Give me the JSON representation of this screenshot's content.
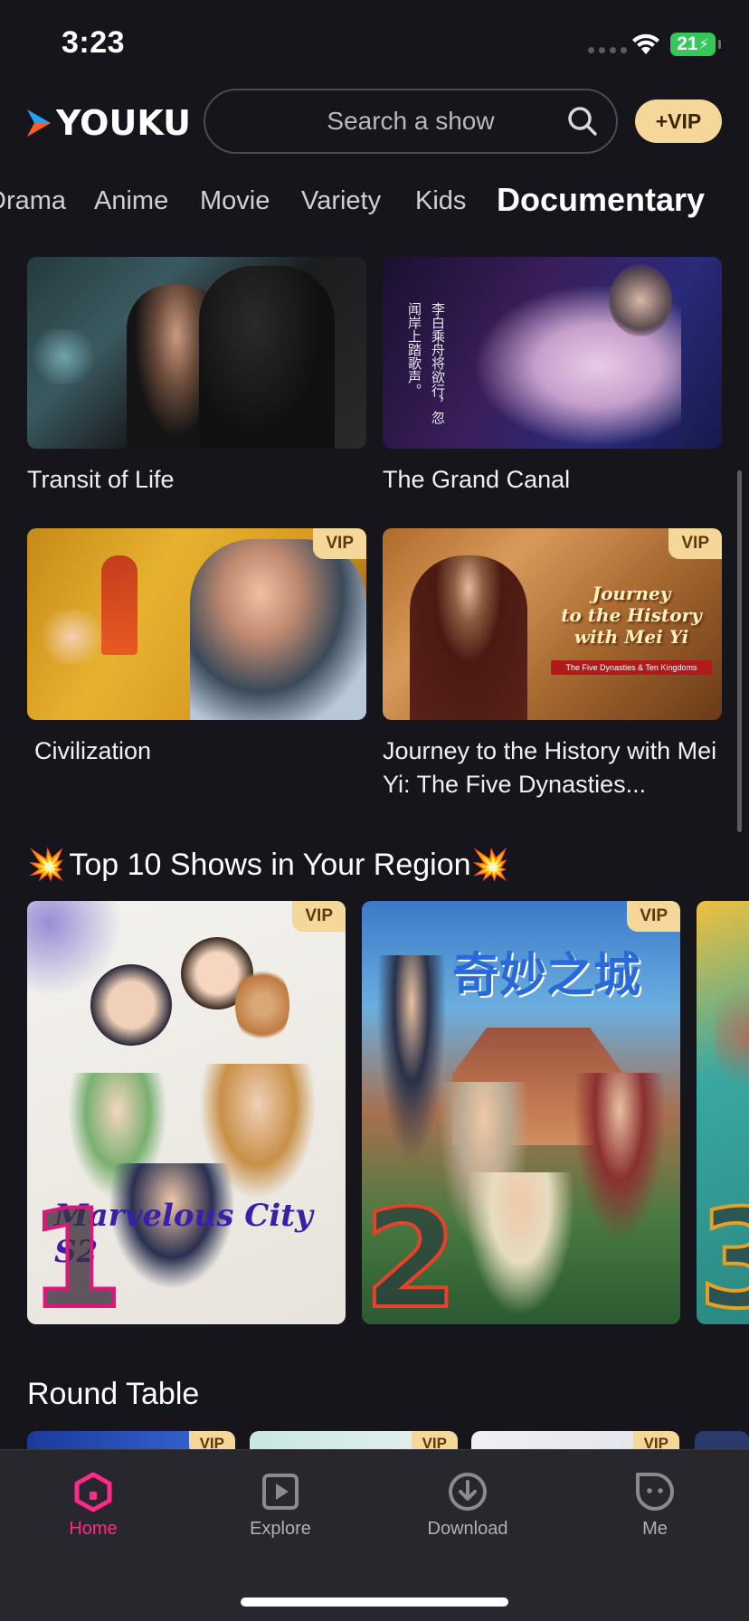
{
  "status": {
    "time": "3:23",
    "battery": "21"
  },
  "header": {
    "logo_text": "YOUKU",
    "search_placeholder": "Search a show",
    "vip_label": "+VIP"
  },
  "tabs": [
    {
      "label": "Drama"
    },
    {
      "label": "Anime"
    },
    {
      "label": "Movie"
    },
    {
      "label": "Variety"
    },
    {
      "label": "Kids"
    },
    {
      "label": "Documentary",
      "active": true
    }
  ],
  "grid": [
    {
      "title": "Transit of Life",
      "vip": false
    },
    {
      "title": "The Grand Canal",
      "vip": false
    },
    {
      "title": "Civilization",
      "vip": true
    },
    {
      "title": "Journey to the History with Mei Yi: The Five Dynasties...",
      "vip": true
    }
  ],
  "thumb_texts": {
    "canal_caption": "李白乘舟将欲行，忽闻岸上踏歌声。",
    "journey_line1": "Journey",
    "journey_line2": "to the History",
    "journey_line3": "with Mei Yi",
    "journey_sub": "The Five Dynasties & Ten Kingdoms"
  },
  "badge_label": "VIP",
  "top10": {
    "title": "Top 10 Shows in Your Region",
    "items": [
      {
        "rank": "1",
        "poster_text": "Marvelous City S2",
        "vip": true
      },
      {
        "rank": "2",
        "poster_text": "奇妙之城",
        "vip": true
      },
      {
        "rank": "3",
        "vip": false
      }
    ]
  },
  "round_table": {
    "title": "Round Table"
  },
  "nav": [
    {
      "label": "Home",
      "active": true
    },
    {
      "label": "Explore"
    },
    {
      "label": "Download"
    },
    {
      "label": "Me"
    }
  ],
  "colors": {
    "background": "#16151b",
    "accent": "#ff2a8a",
    "vip_gold": "#f6d79a"
  }
}
